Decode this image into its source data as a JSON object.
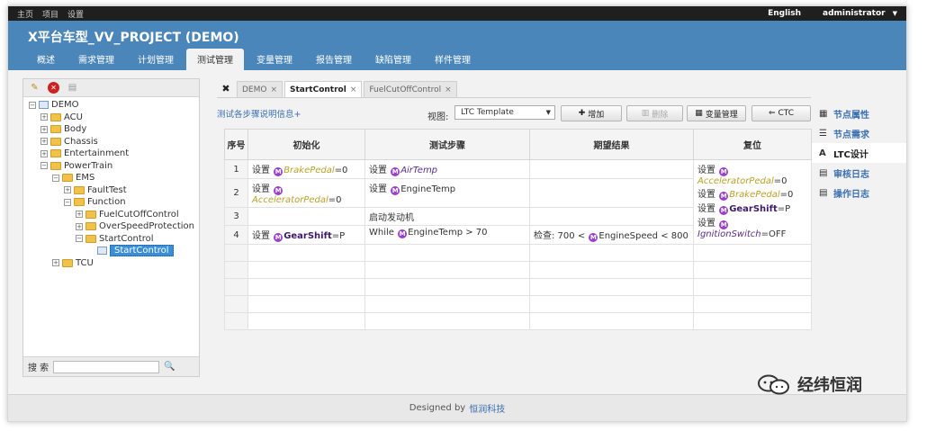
{
  "topbar": {
    "links": [
      "主页",
      "项目",
      "设置"
    ],
    "language": "English",
    "user": "administrator"
  },
  "header": {
    "title": "X平台车型_VV_PROJECT (DEMO)",
    "tabs": [
      "概述",
      "需求管理",
      "计划管理",
      "测试管理",
      "变量管理",
      "报告管理",
      "缺陷管理",
      "样件管理"
    ],
    "active_tab": "测试管理"
  },
  "tree": {
    "nodes": [
      {
        "label": "DEMO",
        "level": 0,
        "kind": "root",
        "exp": "⊟"
      },
      {
        "label": "ACU",
        "level": 1,
        "kind": "folder",
        "exp": "⊞"
      },
      {
        "label": "Body",
        "level": 1,
        "kind": "folder",
        "exp": "⊞"
      },
      {
        "label": "Chassis",
        "level": 1,
        "kind": "folder",
        "exp": "⊞"
      },
      {
        "label": "Entertainment",
        "level": 1,
        "kind": "folder",
        "exp": "⊞"
      },
      {
        "label": "PowerTrain",
        "level": 1,
        "kind": "folder",
        "exp": "⊟"
      },
      {
        "label": "EMS",
        "level": 2,
        "kind": "folder",
        "exp": "⊟"
      },
      {
        "label": "FaultTest",
        "level": 3,
        "kind": "folder",
        "exp": "⊞"
      },
      {
        "label": "Function",
        "level": 3,
        "kind": "folder",
        "exp": "⊟"
      },
      {
        "label": "FuelCutOffControl",
        "level": 4,
        "kind": "folder",
        "exp": "⊞"
      },
      {
        "label": "OverSpeedProtection",
        "level": 4,
        "kind": "folder",
        "exp": "⊞"
      },
      {
        "label": "StartControl",
        "level": 4,
        "kind": "folder",
        "exp": "⊟"
      },
      {
        "label": "StartControl",
        "level": 5,
        "kind": "item",
        "exp": "",
        "selected": true
      },
      {
        "label": "TCU",
        "level": 2,
        "kind": "folder",
        "exp": "⊞"
      }
    ]
  },
  "search": {
    "label": "搜 索",
    "value": ""
  },
  "doc_tabs": [
    {
      "label": "DEMO",
      "active": false
    },
    {
      "label": "StartControl",
      "active": true
    },
    {
      "label": "FuelCutOffControl",
      "active": false
    }
  ],
  "options": {
    "explain_link": "测试各步骤说明信息+",
    "view_label": "视图:",
    "view_value": "LTC Template",
    "buttons": {
      "add": "增加",
      "delete": "删除",
      "vars": "变量管理",
      "ctc": "CTC"
    }
  },
  "table": {
    "headers": {
      "no": "序号",
      "init": "初始化",
      "steps": "测试步骤",
      "expected": "期望结果",
      "reset": "复位"
    },
    "rows": [
      {
        "no": "1",
        "init": {
          "pre": "设置",
          "sig": "BrakePedal",
          "post": "=0"
        },
        "step": {
          "pre": "设置",
          "sig": "AirTemp"
        }
      },
      {
        "no": "2",
        "init": {
          "pre": "设置",
          "sig": "AcceleratorPedal",
          "post": "=0"
        },
        "step": {
          "pre": "设置",
          "sig": "EngineTemp"
        }
      },
      {
        "no": "3",
        "step": {
          "text": "启动发动机"
        }
      },
      {
        "no": "4",
        "init": {
          "pre": "设置",
          "sig": "GearShift",
          "post": "=P"
        },
        "step": {
          "pre": "While",
          "sig": "EngineTemp",
          "post": " > 70"
        },
        "expected": {
          "pre": "检查:  700 <",
          "sig": "EngineSpeed",
          "post": " < 800"
        }
      }
    ],
    "reset": [
      {
        "pre": "设置",
        "sig": "AcceleratorPedal",
        "post": "=0"
      },
      {
        "pre": "设置",
        "sig": "BrakePedal",
        "post": "=0"
      },
      {
        "pre": "设置",
        "sig": "GearShift",
        "post": "=P"
      },
      {
        "pre": "设置",
        "sig": "IgnitionSwitch",
        "post": "=OFF"
      }
    ]
  },
  "right_panel": [
    {
      "label": "节点属性",
      "icon": "grid-icon",
      "active": false
    },
    {
      "label": "节点需求",
      "icon": "list-icon",
      "active": false
    },
    {
      "label": "LTC设计",
      "icon": "font-a-icon",
      "active": true
    },
    {
      "label": "审核日志",
      "icon": "log-icon",
      "active": false
    },
    {
      "label": "操作日志",
      "icon": "log-icon",
      "active": false
    }
  ],
  "footer": {
    "prefix": "Designed by",
    "company": "恒润科技"
  },
  "watermark": "经纬恒润",
  "colors": {
    "header": "#4a86b9",
    "signal_gold": "#b9a12a",
    "signal_purple": "#5a2c8a",
    "marker": "#9a3fc8",
    "link": "#3b6fb0"
  }
}
